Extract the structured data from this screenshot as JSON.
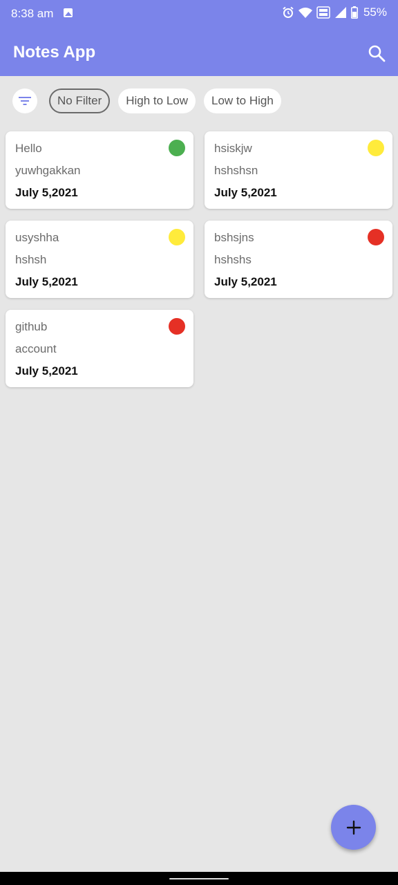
{
  "status_bar": {
    "time": "8:38 am",
    "battery_percent": "55%",
    "icons": [
      "image-icon",
      "alarm-icon",
      "wifi-icon",
      "volte-icon",
      "signal-icon",
      "battery-icon"
    ]
  },
  "app_bar": {
    "title": "Notes App",
    "search_icon": "search-icon",
    "color": "#7b84ea"
  },
  "filters": {
    "icon": "filter-icon",
    "options": [
      {
        "label": "No Filter",
        "selected": true
      },
      {
        "label": "High to Low",
        "selected": false
      },
      {
        "label": "Low to High",
        "selected": false
      }
    ]
  },
  "notes": [
    {
      "title": "Hello",
      "body": "yuwhgakkan",
      "date": "July 5,2021",
      "priority_color": "#4caf50"
    },
    {
      "title": "hsiskjw",
      "body": "hshshsn",
      "date": "July 5,2021",
      "priority_color": "#ffeb3b"
    },
    {
      "title": "usyshha",
      "body": "hshsh",
      "date": "July 5,2021",
      "priority_color": "#ffeb3b"
    },
    {
      "title": "bshsjns",
      "body": "hshshs",
      "date": "July 5,2021",
      "priority_color": "#e53025"
    },
    {
      "title": "github",
      "body": "account",
      "date": "July 5,2021",
      "priority_color": "#e53025"
    }
  ],
  "fab": {
    "icon": "plus-icon"
  }
}
